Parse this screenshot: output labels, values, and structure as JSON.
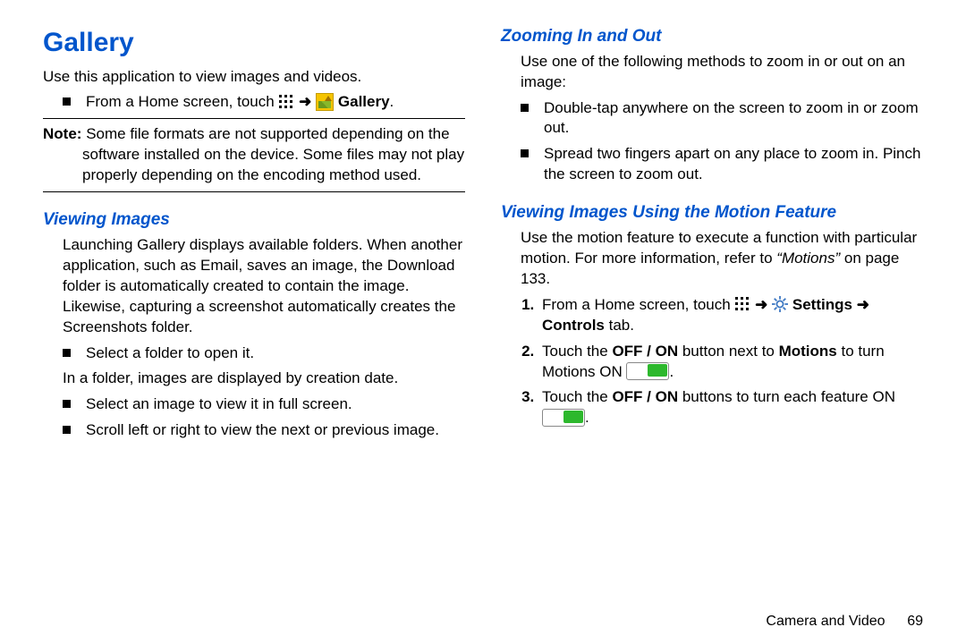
{
  "left": {
    "title": "Gallery",
    "intro": "Use this application to view images and videos.",
    "step_from_home": {
      "prefix": "From a Home screen, touch",
      "arrow": "➜",
      "gallery_label": "Gallery",
      "period": "."
    },
    "note_label": "Note:",
    "note_text": "Some file formats are not supported depending on the software installed on the device. Some files may not play properly depending on the encoding method used.",
    "viewing_heading": "Viewing Images",
    "viewing_para": "Launching Gallery displays available folders. When another application, such as Email, saves an image, the Download folder is automatically created to contain the image. Likewise, capturing a screenshot automatically creates the Screenshots folder.",
    "bullet_select_folder": "Select a folder to open it.",
    "after_folder": "In a folder, images are displayed by creation date.",
    "bullet_select_image": "Select an image to view it in full screen.",
    "bullet_scroll": "Scroll left or right to view the next or previous image."
  },
  "right": {
    "zoom_heading": "Zooming In and Out",
    "zoom_intro": "Use one of the following methods to zoom in or out on an image:",
    "zoom_b1": "Double-tap anywhere on the screen to zoom in or zoom out.",
    "zoom_b2": "Spread two fingers apart on any place to zoom in. Pinch the screen to zoom out.",
    "motion_heading": "Viewing Images Using the Motion Feature",
    "motion_intro_a": "Use the motion feature to execute a function with particular motion. For more information, refer to ",
    "motion_ref": "“Motions”",
    "motion_intro_b": " on page 133.",
    "step1": {
      "prefix": "From a Home screen, touch",
      "arrow": "➜",
      "settings": "Settings",
      "arrow2": "➜",
      "controls": "Controls",
      "tab": " tab",
      "period": "."
    },
    "step2_a": "Touch the ",
    "step2_b": "OFF / ON",
    "step2_c": " button next to ",
    "step2_d": "Motions",
    "step2_e": " to turn Motions ON ",
    "step2_f": ".",
    "step3_a": "Touch the ",
    "step3_b": "OFF / ON",
    "step3_c": " buttons to turn each feature ON ",
    "step3_d": "."
  },
  "footer": {
    "chapter": "Camera and Video",
    "page": "69"
  }
}
